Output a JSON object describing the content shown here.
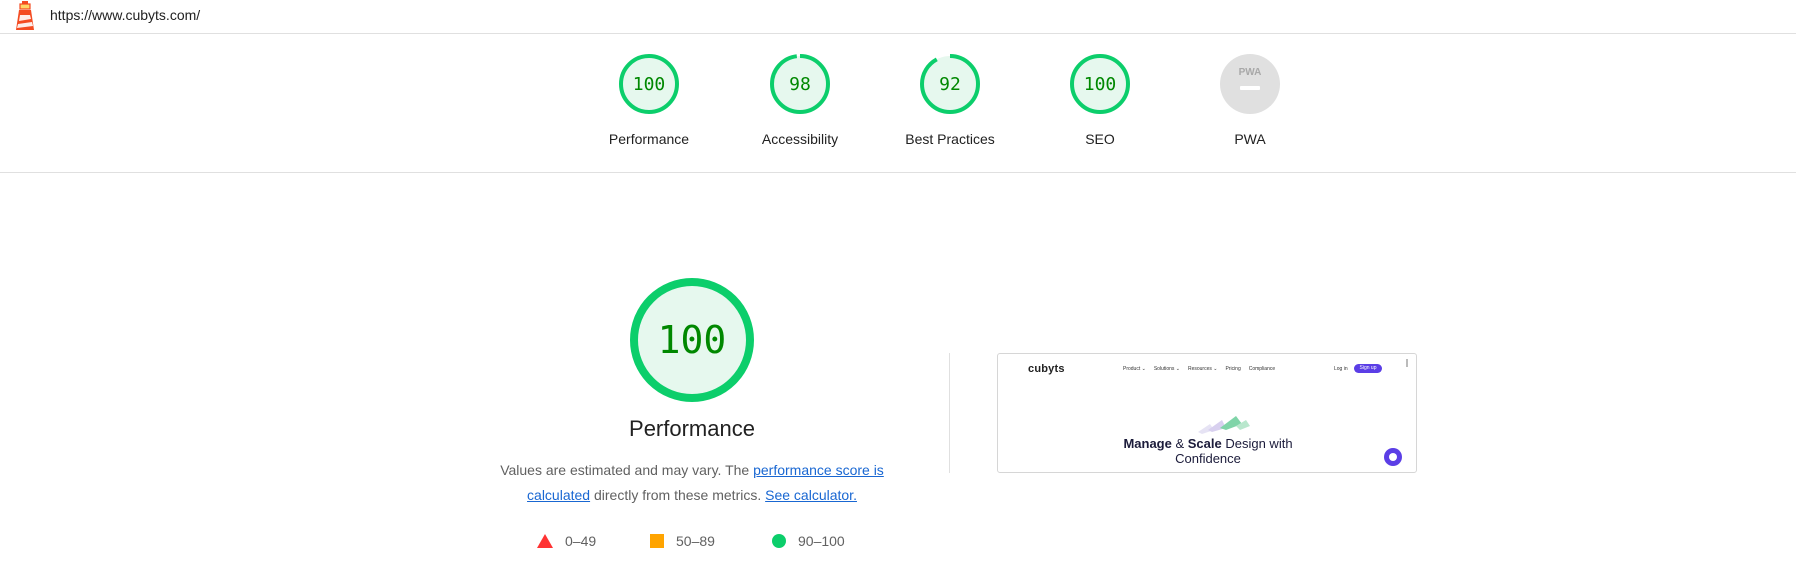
{
  "header": {
    "url": "https://www.cubyts.com/",
    "logo_icon": "lighthouse-icon"
  },
  "gauges": [
    {
      "label": "Performance",
      "score": "100",
      "value": 100
    },
    {
      "label": "Accessibility",
      "score": "98",
      "value": 98
    },
    {
      "label": "Best Practices",
      "score": "92",
      "value": 92
    },
    {
      "label": "SEO",
      "score": "100",
      "value": 100
    },
    {
      "label": "PWA",
      "score": "",
      "value": null,
      "badge_text": "PWA"
    }
  ],
  "colors": {
    "pass": "#0cce6b",
    "pass_text": "#008800",
    "pass_bg": "#e6f8ee",
    "average": "#ffa400",
    "fail": "#ff3333",
    "na": "#e0e0e0",
    "link": "#1967d2"
  },
  "performance": {
    "score": "100",
    "value": 100,
    "title": "Performance",
    "desc_prefix": "Values are estimated and may vary. The ",
    "desc_link1": "performance score is calculated",
    "desc_mid": " directly from these metrics. ",
    "desc_link2": "See calculator.",
    "legend": [
      {
        "shape": "triangle",
        "range": "0–49"
      },
      {
        "shape": "square",
        "range": "50–89"
      },
      {
        "shape": "circle",
        "range": "90–100"
      }
    ]
  },
  "screenshot": {
    "logo": "cubyts",
    "nav": [
      "Product ⌄",
      "Solutions ⌄",
      "Resources ⌄",
      "Pricing",
      "Compliance"
    ],
    "login": "Log in",
    "signup": "Sign up",
    "headline_bold1": "Manage",
    "headline_amp": " & ",
    "headline_bold2": "Scale",
    "headline_rest": " Design with",
    "headline_line2": "Confidence"
  }
}
